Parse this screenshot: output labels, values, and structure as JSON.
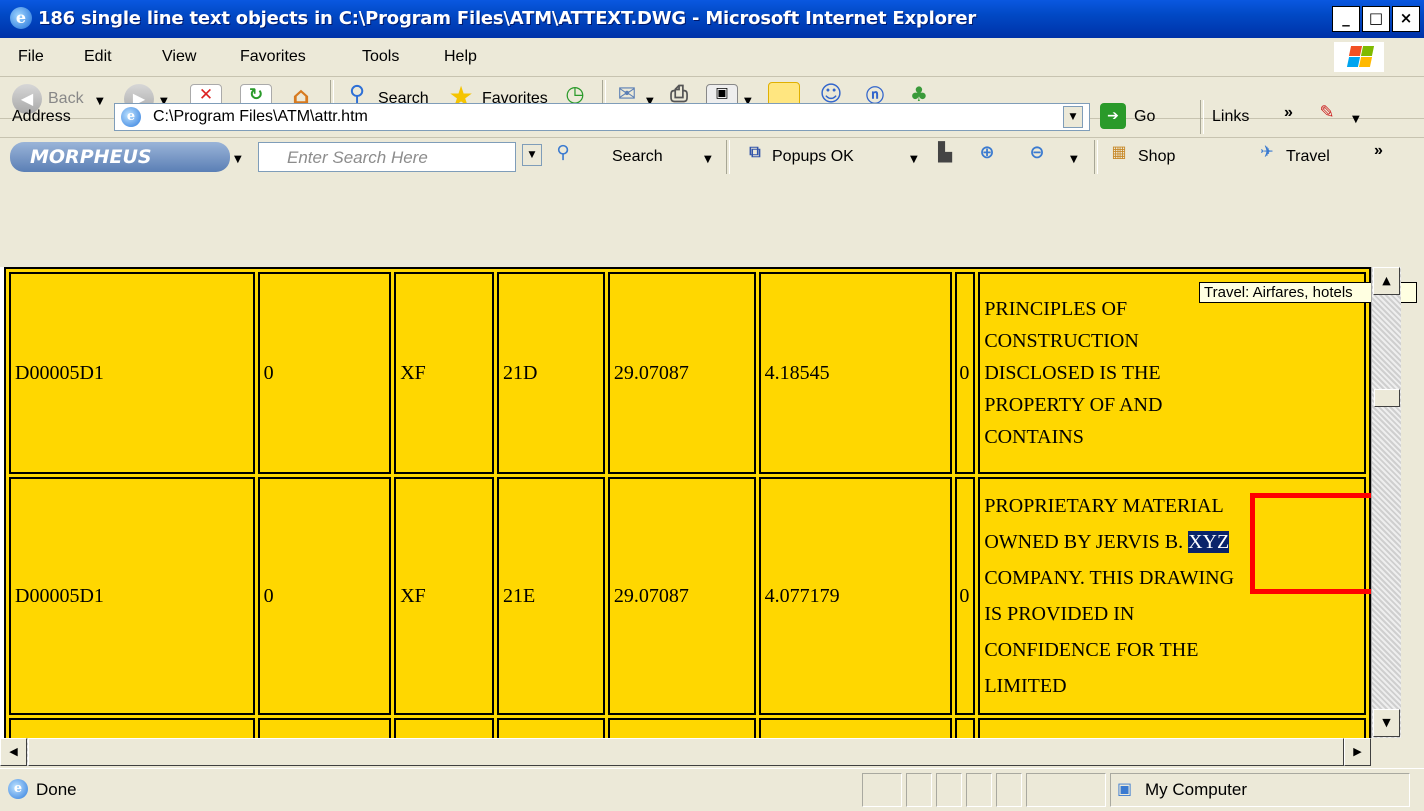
{
  "window": {
    "title": "186 single line text objects in C:\\Program Files\\ATM\\ATTEXT.DWG - Microsoft Internet Explorer",
    "min_symbol": "_",
    "max_symbol": "□",
    "close_symbol": "×"
  },
  "menu": [
    "File",
    "Edit",
    "View",
    "Favorites",
    "Tools",
    "Help"
  ],
  "toolbar": {
    "back_label": "Back",
    "search_label": "Search",
    "favorites_label": "Favorites"
  },
  "address": {
    "label": "Address",
    "value": "C:\\Program Files\\ATM\\attr.htm",
    "go_label": "Go",
    "links_label": "Links"
  },
  "morpheus": {
    "logo_text": "MORPHEUS",
    "search_placeholder": "Enter Search Here",
    "search_label": "Search",
    "popups_label": "Popups OK",
    "shop_label": "Shop",
    "travel_label": "Travel"
  },
  "tooltip": "Travel: Airfares, hotels",
  "table": {
    "rows": [
      {
        "cells": [
          "D00005D1",
          "0",
          "XF",
          "21D",
          "29.07087",
          "4.18545",
          "0"
        ],
        "text_lines": [
          "PRINCIPLES OF",
          "CONSTRUCTION",
          "DISCLOSED IS THE",
          "PROPERTY OF AND",
          "CONTAINS"
        ]
      },
      {
        "cells": [
          "D00005D1",
          "0",
          "XF",
          "21E",
          "29.07087",
          "4.077179",
          "0"
        ],
        "text_lines_before": "PROPRIETARY MATERIAL",
        "line2_prefix": "OWNED BY JERVIS B. ",
        "highlight": "XYZ",
        "text_lines_after": [
          "COMPANY. THIS DRAWING",
          "IS PROVIDED IN",
          "CONFIDENCE FOR THE",
          "LIMITED"
        ]
      }
    ]
  },
  "status": {
    "text": "Done",
    "zone": "My Computer"
  }
}
